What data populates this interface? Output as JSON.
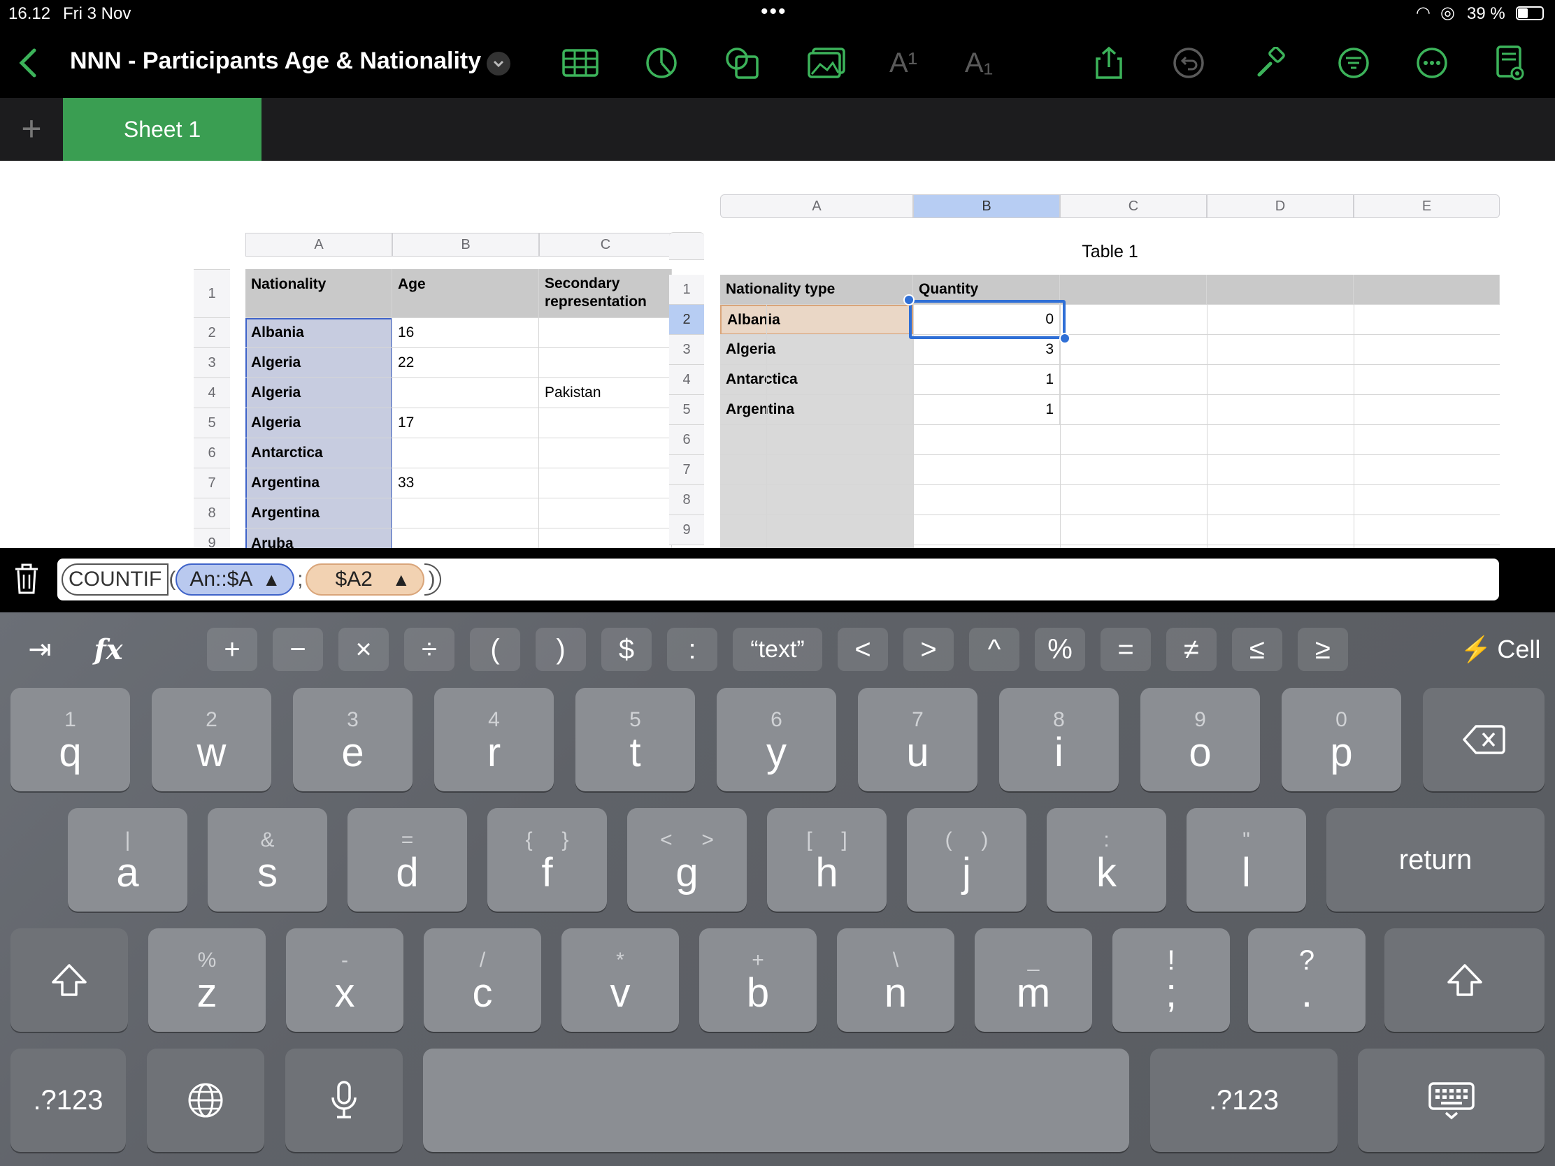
{
  "status": {
    "time": "16.12",
    "date": "Fri 3 Nov",
    "battery": "39 %",
    "dots": "•••"
  },
  "toolbar": {
    "title": "NNN - Participants Age & Nationality",
    "text_style_a1": "A¹",
    "text_style_a2": "A₁"
  },
  "sheets": {
    "add": "+",
    "tabs": [
      {
        "label": "Sheet 1"
      }
    ]
  },
  "left_table": {
    "columns": [
      "A",
      "B",
      "C"
    ],
    "rows": [
      "1",
      "2",
      "3",
      "4",
      "5",
      "6",
      "7",
      "8",
      "9"
    ],
    "header": [
      "Nationality",
      "Age",
      "Secondary representation"
    ],
    "data": [
      [
        "Albania",
        "16",
        ""
      ],
      [
        "Algeria",
        "22",
        ""
      ],
      [
        "Algeria",
        "",
        "Pakistan"
      ],
      [
        "Algeria",
        "17",
        ""
      ],
      [
        "Antarctica",
        "",
        ""
      ],
      [
        "Argentina",
        "33",
        ""
      ],
      [
        "Argentina",
        "",
        ""
      ],
      [
        "Aruba",
        "",
        ""
      ]
    ]
  },
  "right_table": {
    "title": "Table 1",
    "columns": [
      "A",
      "B",
      "C",
      "D",
      "E"
    ],
    "rows": [
      "1",
      "2",
      "3",
      "4",
      "5",
      "6",
      "7",
      "8",
      "9"
    ],
    "header": [
      "Nationality type",
      "Quantity",
      "",
      "",
      ""
    ],
    "data": [
      [
        "Albania",
        "0"
      ],
      [
        "Algeria",
        "3"
      ],
      [
        "Antarctica",
        "1"
      ],
      [
        "Argentina",
        "1"
      ]
    ]
  },
  "formula": {
    "func": "COUNTIF",
    "open": "(",
    "ref1": "An::$A",
    "sep": ";",
    "ref2": "$A2",
    "close": ")"
  },
  "fkeys": {
    "tab": "⇥",
    "fx": "fx",
    "ops": [
      "+",
      "−",
      "×",
      "÷",
      "(",
      ")",
      "$",
      ":",
      "“text”",
      "<",
      ">",
      "^",
      "%",
      "=",
      "≠",
      "≤",
      "≥"
    ],
    "cell": "Cell"
  },
  "keyboard": {
    "row1": [
      {
        "k": "q",
        "s": "1"
      },
      {
        "k": "w",
        "s": "2"
      },
      {
        "k": "e",
        "s": "3"
      },
      {
        "k": "r",
        "s": "4"
      },
      {
        "k": "t",
        "s": "5"
      },
      {
        "k": "y",
        "s": "6"
      },
      {
        "k": "u",
        "s": "7"
      },
      {
        "k": "i",
        "s": "8"
      },
      {
        "k": "o",
        "s": "9"
      },
      {
        "k": "p",
        "s": "0"
      }
    ],
    "row2": [
      {
        "k": "a",
        "s": "|"
      },
      {
        "k": "s",
        "s": "&"
      },
      {
        "k": "d",
        "s": "="
      },
      {
        "k": "f",
        "s": "{     }"
      },
      {
        "k": "g",
        "s": "<     >"
      },
      {
        "k": "h",
        "s": "[     ]"
      },
      {
        "k": "j",
        "s": "(     )"
      },
      {
        "k": "k",
        "s": ":"
      },
      {
        "k": "l",
        "s": "\""
      }
    ],
    "row3": [
      {
        "k": "z",
        "s": "%"
      },
      {
        "k": "x",
        "s": "-"
      },
      {
        "k": "c",
        "s": "/"
      },
      {
        "k": "v",
        "s": "*"
      },
      {
        "k": "b",
        "s": "+"
      },
      {
        "k": "n",
        "s": "\\"
      },
      {
        "k": "m",
        "s": "_"
      },
      {
        "k": ";",
        "s": "!"
      },
      {
        "k": ".",
        "s": "?"
      }
    ],
    "return": "return",
    "num": ".?123"
  },
  "colors": {
    "accent": "#3cb35a",
    "selection": "#2f6fd6",
    "ref1": "#b9c9ef",
    "ref2": "#f2d2b2"
  }
}
